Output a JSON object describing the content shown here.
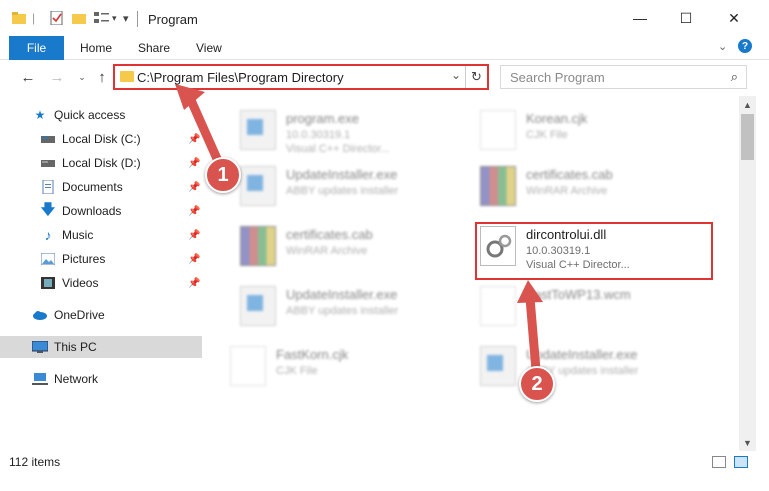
{
  "window": {
    "title": "Program",
    "controls": {
      "minimize": "—",
      "maximize": "☐",
      "close": "✕"
    }
  },
  "ribbon": {
    "tabs": [
      {
        "label": "File"
      },
      {
        "label": "Home"
      },
      {
        "label": "Share"
      },
      {
        "label": "View"
      }
    ],
    "help": "?"
  },
  "address_bar": {
    "path": "C:\\Program Files\\Program Directory"
  },
  "search": {
    "placeholder": "Search Program"
  },
  "nav_pane": {
    "items": [
      {
        "label": "Quick access",
        "icon": "star-icon",
        "pinned": false
      },
      {
        "label": "Local Disk (C:)",
        "icon": "drive-icon",
        "pinned": true
      },
      {
        "label": "Local Disk (D:)",
        "icon": "drive-icon",
        "pinned": true
      },
      {
        "label": "Documents",
        "icon": "documents-icon",
        "pinned": true
      },
      {
        "label": "Downloads",
        "icon": "download-icon",
        "pinned": true
      },
      {
        "label": "Music",
        "icon": "music-icon",
        "pinned": true
      },
      {
        "label": "Pictures",
        "icon": "pictures-icon",
        "pinned": true
      },
      {
        "label": "Videos",
        "icon": "videos-icon",
        "pinned": true
      },
      {
        "label": "OneDrive",
        "icon": "cloud-icon",
        "pinned": false
      },
      {
        "label": "This PC",
        "icon": "computer-icon",
        "pinned": false,
        "selected": true
      },
      {
        "label": "Network",
        "icon": "network-icon",
        "pinned": false
      }
    ]
  },
  "files": [
    {
      "name": "program.exe",
      "line2": "10.0.30319.1",
      "line3": "Visual C++ Director...",
      "type": "exe"
    },
    {
      "name": "Korean.cjk",
      "line2": "CJK File",
      "line3": "",
      "type": "doc"
    },
    {
      "name": "UpdateInstaller.exe",
      "line2": "ABBY updates installer",
      "line3": "",
      "type": "exe"
    },
    {
      "name": "certificates.cab",
      "line2": "WinRAR Archive",
      "line3": "",
      "type": "rar"
    },
    {
      "name": "certificates.cab",
      "line2": "WinRAR Archive",
      "line3": "",
      "type": "rar"
    },
    {
      "name": "dircontrolui.dll",
      "line2": "10.0.30319.1",
      "line3": "Visual C++ Director...",
      "type": "dll",
      "highlighted": true
    },
    {
      "name": "UpdateInstaller.exe",
      "line2": "ABBY updates installer",
      "line3": "",
      "type": "exe"
    },
    {
      "name": "FastToWP13.wcm",
      "line2": "",
      "line3": "",
      "type": "doc"
    },
    {
      "name": "FastKorn.cjk",
      "line2": "CJK File",
      "line3": "",
      "type": "doc"
    },
    {
      "name": "UpdateInstaller.exe",
      "line2": "ABBY updates installer",
      "line3": "",
      "type": "exe"
    }
  ],
  "status_bar": {
    "item_count": "112 items"
  },
  "callouts": [
    {
      "number": "1"
    },
    {
      "number": "2"
    }
  ],
  "colors": {
    "accent": "#1979ca",
    "callout": "#d9534f",
    "highlight_border": "#e03434"
  }
}
